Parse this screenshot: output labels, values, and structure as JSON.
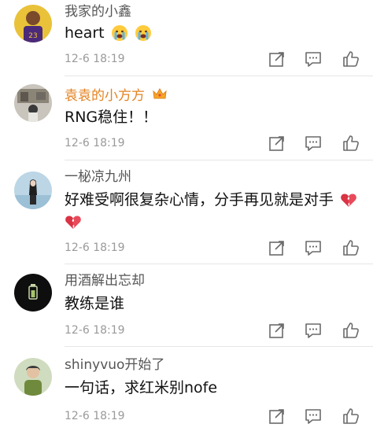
{
  "comments": [
    {
      "name": "我家的小鑫",
      "content": "heart",
      "emojis": [
        "crying-face",
        "crying-face"
      ],
      "time": "12-6 18:19",
      "vip": false
    },
    {
      "name": "袁袁的小方方",
      "content": "RNG稳住！！",
      "emojis": [],
      "time": "12-6 18:19",
      "vip": true
    },
    {
      "name": "一柲凉九州",
      "content_line1": "好难受啊很复杂心情，分手再见就是对手",
      "emojis": [
        "broken-heart",
        "broken-heart"
      ],
      "time": "12-6 18:19",
      "vip": false
    },
    {
      "name": "用酒解出忘却",
      "content": "教练是谁",
      "emojis": [],
      "time": "12-6 18:19",
      "vip": false
    },
    {
      "name": "shinyvuo开始了",
      "content": "一句话，求红米别nofe",
      "emojis": [],
      "time": "12-6 18:19",
      "vip": false
    }
  ],
  "colors": {
    "name": "#555555",
    "name_vip": "#e3821f",
    "content": "#111111",
    "time": "#9a9a9a",
    "divider": "#e6e6e6"
  },
  "icons": {
    "share": "share-icon",
    "reply": "comment-icon",
    "like": "thumbs-up-icon",
    "crown": "crown-icon"
  }
}
